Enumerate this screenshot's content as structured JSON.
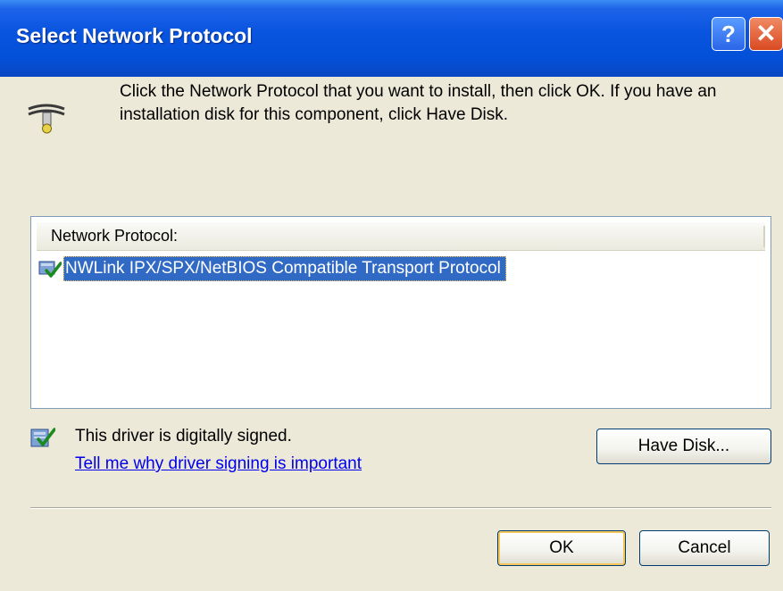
{
  "window": {
    "title": "Select Network Protocol",
    "help_glyph": "?",
    "close_glyph": "✕"
  },
  "intro": {
    "icon": "network-protocol-icon",
    "text": "Click the Network Protocol that you want to install, then click OK. If you have an installation disk for this component, click Have Disk."
  },
  "protocol_list": {
    "header": "Network Protocol:",
    "items": [
      {
        "label": "NWLink IPX/SPX/NetBIOS Compatible Transport Protocol",
        "selected": true,
        "icon": "protocol-item-icon"
      }
    ]
  },
  "signing": {
    "icon": "signed-driver-icon",
    "status": "This driver is digitally signed.",
    "link": "Tell me why driver signing is important"
  },
  "buttons": {
    "have_disk": "Have Disk...",
    "ok": "OK",
    "cancel": "Cancel"
  },
  "colors": {
    "titlebar": "#0a55e0",
    "selection": "#316ac5",
    "dialog_bg": "#ece9d8",
    "link": "#0000ee"
  }
}
